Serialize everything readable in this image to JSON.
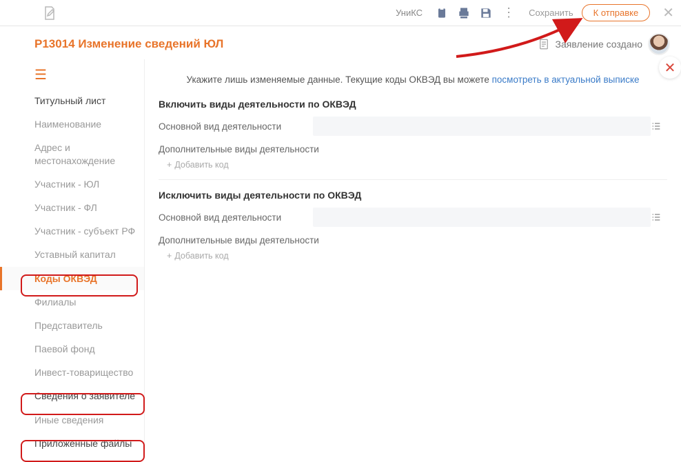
{
  "topbar": {
    "app_label": "УниКС",
    "save_label": "Сохранить",
    "send_label": "К отправке"
  },
  "header": {
    "title": "Р13014 Изменение сведений ЮЛ",
    "status": "Заявление создано"
  },
  "sidebar": {
    "items": [
      {
        "label": "Титульный лист",
        "state": "dark"
      },
      {
        "label": "Наименование",
        "state": ""
      },
      {
        "label": "Адрес и местонахождение",
        "state": ""
      },
      {
        "label": "Участник - ЮЛ",
        "state": ""
      },
      {
        "label": "Участник - ФЛ",
        "state": ""
      },
      {
        "label": "Участник - субъект РФ",
        "state": ""
      },
      {
        "label": "Уставный капитал",
        "state": ""
      },
      {
        "label": "Коды ОКВЭД",
        "state": "active"
      },
      {
        "label": "Филиалы",
        "state": ""
      },
      {
        "label": "Представитель",
        "state": ""
      },
      {
        "label": "Паевой фонд",
        "state": ""
      },
      {
        "label": "Инвест-товарищество",
        "state": ""
      },
      {
        "label": "Сведения о заявителе",
        "state": "dark"
      },
      {
        "label": "Иные сведения",
        "state": ""
      },
      {
        "label": "Приложенные файлы",
        "state": "dark"
      }
    ]
  },
  "main": {
    "hint_prefix": "Укажите лишь изменяемые данные. Текущие коды ОКВЭД вы можете ",
    "hint_link": "посмотреть в актуальной выписке",
    "include_heading": "Включить виды деятельности по ОКВЭД",
    "exclude_heading": "Исключить виды деятельности по ОКВЭД",
    "main_activity_label": "Основной вид деятельности",
    "additional_label": "Дополнительные виды деятельности",
    "add_code_label": "Добавить код"
  }
}
